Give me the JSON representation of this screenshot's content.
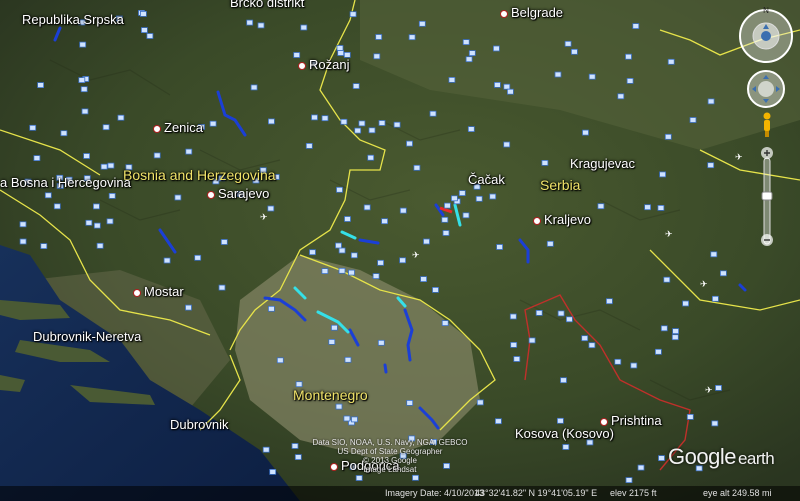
{
  "places": {
    "republika_srpska": "Republika Srpska",
    "brcko": "Brčko distrikt",
    "belgrade": "Belgrade",
    "rozanj": "Rožanj",
    "zenica": "Zenica",
    "bosnia": "Bosnia and Herzegovina",
    "federacija": "a Bosna i Hercegovina",
    "sarajevo": "Sarajevo",
    "cacak": "Čačak",
    "kragujevac": "Kragujevac",
    "serbia": "Serbia",
    "kraljevo": "Kraljevo",
    "mostar": "Mostar",
    "dubrovnik_neretva": "Dubrovnik-Neretva",
    "montenegro": "Montenegro",
    "dubrovnik": "Dubrovnik",
    "podgorica": "Podgorica",
    "kosovo": "Kosova (Kosovo)",
    "prishtina": "Prishtina"
  },
  "attribution": {
    "line1": "Data SIO, NOAA, U.S. Navy, NGA, GEBCO",
    "line2": "US Dept of State Geographer",
    "line3": "© 2013 Google",
    "line4": "Image Landsat"
  },
  "status_bar": {
    "imagery_date": "Imagery Date: 4/10/2013",
    "coordinates": "43°32'41.82\" N  19°41'05.19\" E",
    "elevation": "elev  2175 ft",
    "eye_alt": "eye alt 249.58 mi"
  },
  "logo": {
    "google": "Google",
    "earth": "earth"
  },
  "controls": {
    "north_label": "N"
  },
  "colors": {
    "country_label": "#f1e46a",
    "border_internal": "#e6e34a",
    "border_kosovo": "#c0302a",
    "river_blue": "#1b3fd6",
    "river_cyan": "#35e0e8"
  },
  "icons": [
    "map-marker-icon",
    "airport-icon",
    "compass-icon",
    "pan-control-icon",
    "pegman-icon",
    "zoom-in-icon",
    "zoom-out-icon"
  ]
}
